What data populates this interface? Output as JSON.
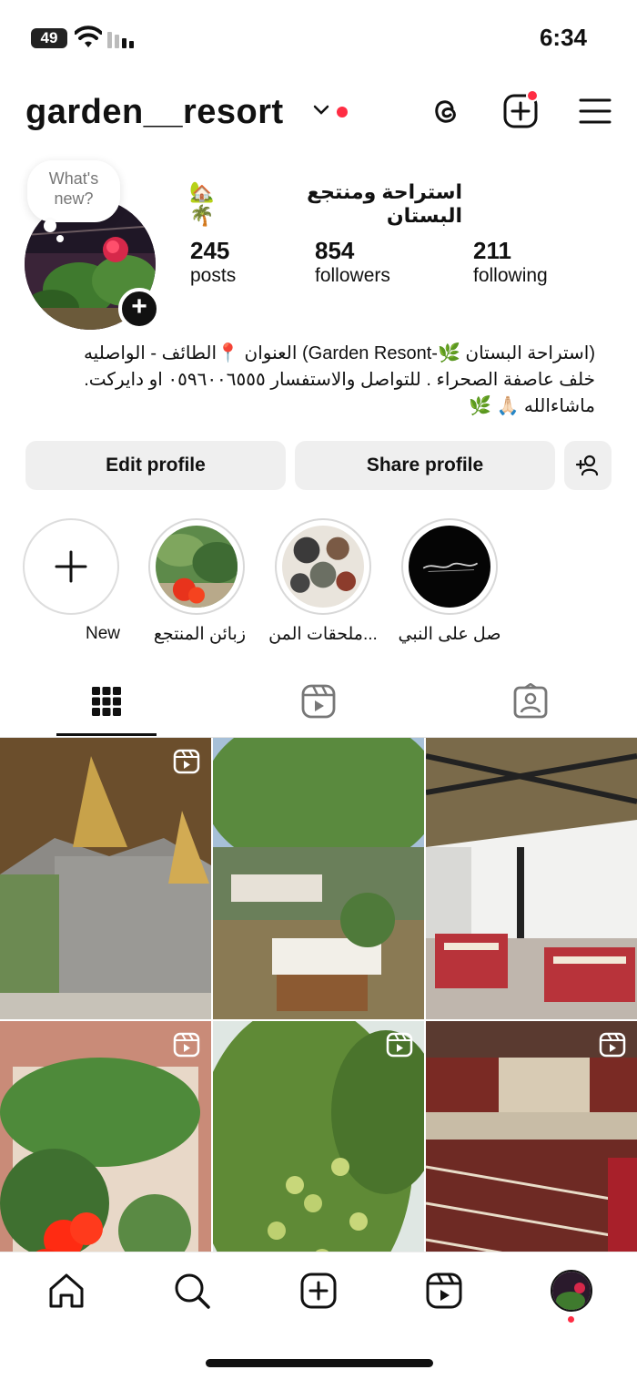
{
  "status_bar": {
    "battery": "49",
    "time": "6:34"
  },
  "header": {
    "username": "garden__resort",
    "icons": [
      "threads-icon",
      "create-post-icon",
      "menu-icon"
    ]
  },
  "profile": {
    "note_placeholder": "What's\nnew?",
    "full_name": "استراحة ومنتجع البستان",
    "full_name_emoji": "🏡🌴",
    "stats": [
      {
        "number": "245",
        "label": "posts"
      },
      {
        "number": "854",
        "label": "followers"
      },
      {
        "number": "211",
        "label": "following"
      }
    ],
    "bio_lines": [
      "(استراحة البستان 🌿-Garden Resont) العنوان 📍الطائف - الواصليه",
      "خلف عاصفة الصحراء . للتواصل والاستفسار ٠٥٩٦٠٠٦٥٥٥ او دايركت.",
      "ماشاءالله 🙏🏻 🌿"
    ]
  },
  "buttons": {
    "edit_profile": "Edit profile",
    "share_profile": "Share profile"
  },
  "highlights": [
    {
      "label": "New"
    },
    {
      "label": "زبائن المنتجع"
    },
    {
      "label": "ملحقات المن..."
    },
    {
      "label": "صل على النبي"
    }
  ],
  "tabs": [
    "grid-tab",
    "reels-tab",
    "tagged-tab"
  ],
  "colors": {
    "accent_red": "#ff2d43",
    "button_bg": "#efefef"
  }
}
